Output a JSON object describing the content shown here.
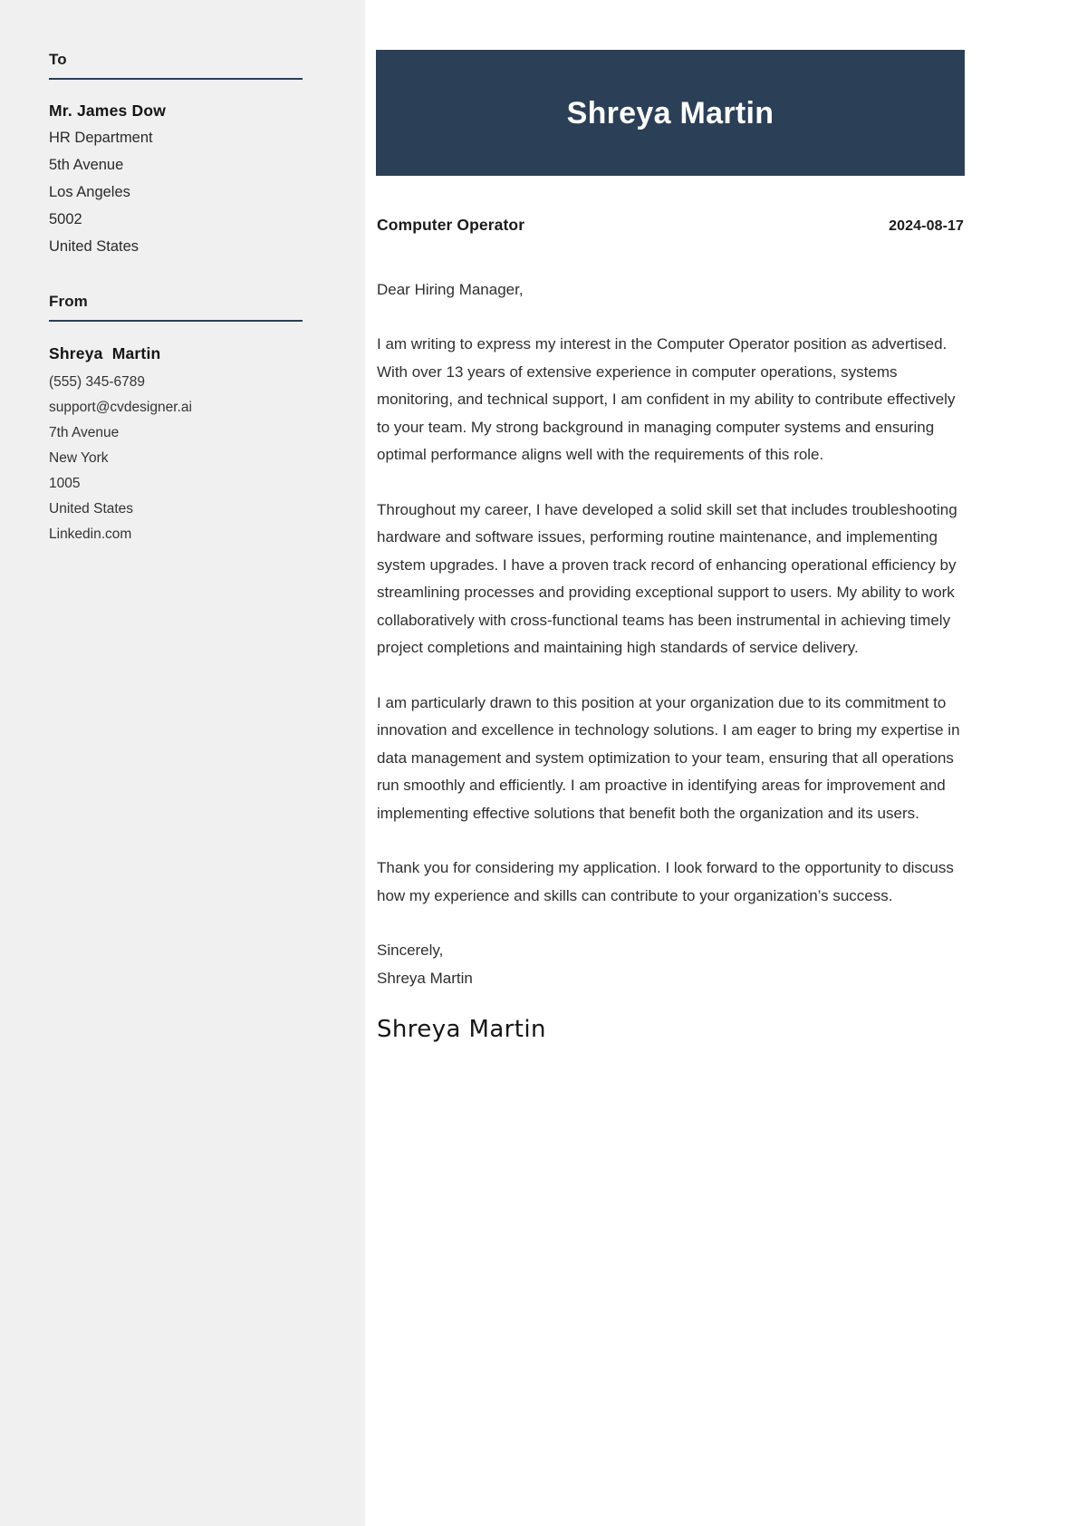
{
  "sidebar": {
    "to": {
      "heading": "To",
      "name": "Mr. James Dow",
      "lines": [
        "HR Department",
        "5th Avenue",
        "Los Angeles",
        "5002",
        "United States"
      ]
    },
    "from": {
      "heading": "From",
      "name": "Shreya  Martin",
      "lines": [
        "(555) 345-6789",
        "support@cvdesigner.ai",
        "7th Avenue",
        "New York",
        "1005",
        "United States",
        "Linkedin.com"
      ]
    }
  },
  "header": {
    "name": "Shreya Martin",
    "banner_color": "#2b3f56"
  },
  "meta": {
    "job_title": "Computer Operator",
    "date": "2024-08-17"
  },
  "letter": {
    "salutation": "Dear Hiring Manager,",
    "paragraphs": [
      "I am writing to express my interest in the Computer Operator position as advertised. With over 13 years of extensive experience in computer operations, systems monitoring, and technical support, I am confident in my ability to contribute effectively to your team. My strong background in managing computer systems and ensuring optimal performance aligns well with the requirements of this role.",
      "Throughout my career, I have developed a solid skill set that includes troubleshooting hardware and software issues, performing routine maintenance, and implementing system upgrades. I have a proven track record of enhancing operational efficiency by streamlining processes and providing exceptional support to users. My ability to work collaboratively with cross-functional teams has been instrumental in achieving timely project completions and maintaining high standards of service delivery.",
      "I am particularly drawn to this position at your organization due to its commitment to innovation and excellence in technology solutions. I am eager to bring my expertise in data management and system optimization to your team, ensuring that all operations run smoothly and efficiently. I am proactive in identifying areas for improvement and implementing effective solutions that benefit both the organization and its users.",
      "Thank you for considering my application. I look forward to the opportunity to discuss how my experience and skills can contribute to your organization’s success."
    ],
    "closing": "Sincerely,",
    "closing_name": "Shreya Martin",
    "signature": "Shreya Martin"
  }
}
